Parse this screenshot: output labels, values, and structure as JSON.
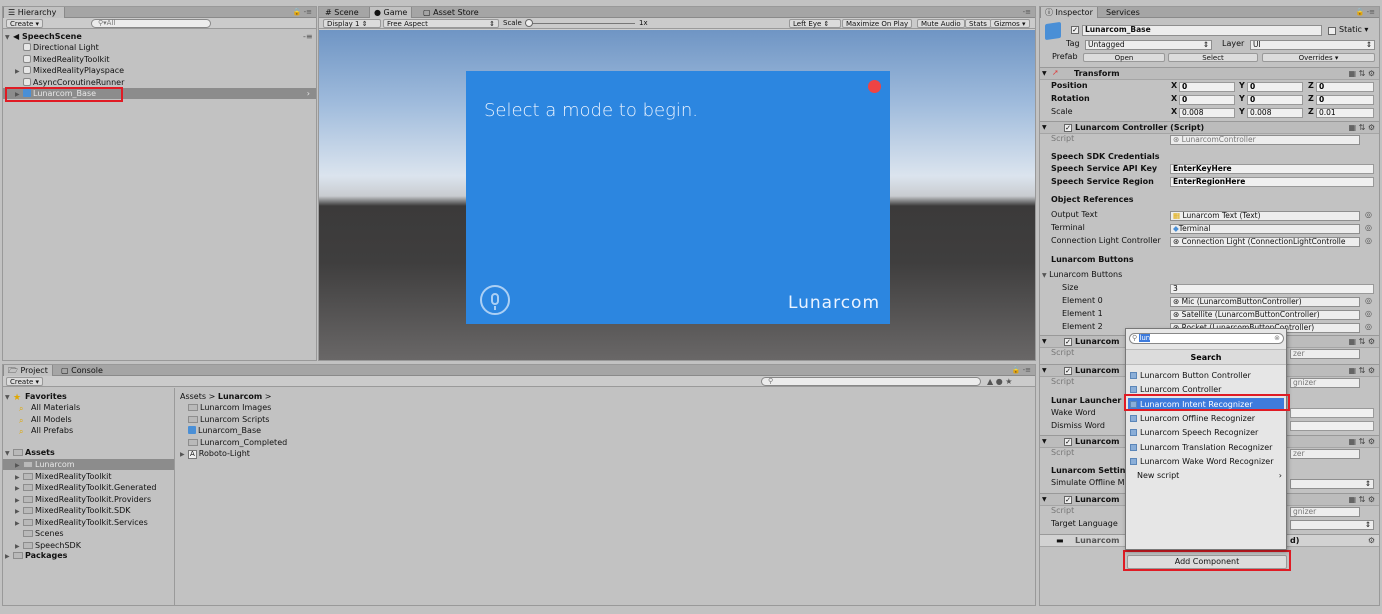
{
  "hierarchy": {
    "tab_label": "Hierarchy",
    "create_label": "Create",
    "search_placeholder": "All",
    "scene_name": "SpeechScene",
    "items": [
      {
        "label": "Directional Light",
        "expandable": false
      },
      {
        "label": "MixedRealityToolkit",
        "expandable": false
      },
      {
        "label": "MixedRealityPlayspace",
        "expandable": true
      },
      {
        "label": "AsyncCoroutineRunner",
        "expandable": false
      },
      {
        "label": "Lunarcom_Base",
        "expandable": true,
        "selected": true
      }
    ]
  },
  "game_view": {
    "tabs": [
      "Scene",
      "Game",
      "Asset Store"
    ],
    "toolbar": {
      "display": "Display 1",
      "aspect": "Free Aspect",
      "scale_label": "Scale",
      "scale_value": "1x",
      "eye": "Left Eye",
      "maximize": "Maximize On Play",
      "mute": "Mute Audio",
      "stats": "Stats",
      "gizmos": "Gizmos"
    },
    "panel_title": "Select a mode to begin.",
    "panel_brand": "Lunarcom",
    "panel_color": "#2c86e0",
    "status_dot_color": "#ef4444"
  },
  "project": {
    "tabs": [
      "Project",
      "Console"
    ],
    "create_label": "Create",
    "favorites_label": "Favorites",
    "favorites": [
      "All Materials",
      "All Models",
      "All Prefabs"
    ],
    "assets_label": "Assets",
    "asset_folders": [
      {
        "label": "Lunarcom",
        "selected": true
      },
      {
        "label": "MixedRealityToolkit",
        "selected": false
      },
      {
        "label": "MixedRealityToolkit.Generated",
        "selected": false
      },
      {
        "label": "MixedRealityToolkit.Providers",
        "selected": false
      },
      {
        "label": "MixedRealityToolkit.SDK",
        "selected": false
      },
      {
        "label": "MixedRealityToolkit.Services",
        "selected": false
      },
      {
        "label": "Scenes",
        "selected": false
      },
      {
        "label": "SpeechSDK",
        "selected": false
      }
    ],
    "packages_label": "Packages",
    "breadcrumb": [
      "Assets",
      "Lunarcom"
    ],
    "contents": [
      {
        "label": "Lunarcom Images",
        "kind": "folder"
      },
      {
        "label": "Lunarcom Scripts",
        "kind": "folder"
      },
      {
        "label": "Lunarcom_Base",
        "kind": "prefab"
      },
      {
        "label": "Lunarcom_Completed",
        "kind": "folder"
      },
      {
        "label": "Roboto-Light",
        "kind": "font"
      }
    ]
  },
  "inspector": {
    "tabs": [
      "Inspector",
      "Services"
    ],
    "object_name": "Lunarcom_Base",
    "static_label": "Static",
    "tag_label": "Tag",
    "tag_value": "Untagged",
    "layer_label": "Layer",
    "layer_value": "UI",
    "prefab_label": "Prefab",
    "prefab_open": "Open",
    "prefab_select": "Select",
    "prefab_overrides": "Overrides",
    "transform": {
      "title": "Transform",
      "position_label": "Position",
      "rotation_label": "Rotation",
      "scale_label": "Scale",
      "position": [
        "0",
        "0",
        "0"
      ],
      "rotation": [
        "0",
        "0",
        "0"
      ],
      "scale": [
        "0.008",
        "0.008",
        "0.01"
      ]
    },
    "controller": {
      "title": "Lunarcom Controller (Script)",
      "script_label": "Script",
      "script_value": "LunarcomController",
      "creds_header": "Speech SDK Credentials",
      "api_key_label": "Speech Service API Key",
      "api_key_value": "EnterKeyHere",
      "region_label": "Speech Service Region",
      "region_value": "EnterRegionHere",
      "refs_header": "Object References",
      "output_text_label": "Output Text",
      "output_text_value": "Lunarcom Text (Text)",
      "terminal_label": "Terminal",
      "terminal_value": "Terminal",
      "conn_label": "Connection Light Controller",
      "conn_value": "Connection Light (ConnectionLightControlle",
      "buttons_header": "Lunarcom Buttons",
      "buttons_fold": "Lunarcom Buttons",
      "size_label": "Size",
      "size_value": "3",
      "elements": [
        {
          "label": "Element 0",
          "value": "Mic (LunarcomButtonController)"
        },
        {
          "label": "Element 1",
          "value": "Satellite (LunarcomButtonController)"
        },
        {
          "label": "Element 2",
          "value": "Rocket (LunarcomButtonController)"
        }
      ]
    },
    "partial_components": [
      {
        "title": "Lunarcom",
        "script_label": "Script",
        "script_tail": "zer"
      },
      {
        "title": "Lunarcom",
        "script_label": "Script",
        "script_tail": "gnizer"
      },
      {
        "title": "Lunarcom",
        "script_label": "Script",
        "script_tail": "zer"
      },
      {
        "title": "Lunarcom",
        "script_label": "Script",
        "script_tail": "gnizer"
      }
    ],
    "launcher_header": "Lunar Launcher",
    "wake_word_label": "Wake Word",
    "dismiss_word_label": "Dismiss Word",
    "settings_header": "Lunarcom Settin",
    "simulate_label": "Simulate Offline M",
    "target_lang_label": "Target Language",
    "missing_row": {
      "left": "Lunarcom",
      "right": "d)"
    },
    "add_component_label": "Add Component"
  },
  "component_popup": {
    "search_value": "lun",
    "header": "Search",
    "items": [
      {
        "label": "Lunarcom Button Controller",
        "highlighted": false
      },
      {
        "label": "Lunarcom Controller",
        "highlighted": false
      },
      {
        "label": "Lunarcom Intent Recognizer",
        "highlighted": true
      },
      {
        "label": "Lunarcom Offline Recognizer",
        "highlighted": false
      },
      {
        "label": "Lunarcom Speech Recognizer",
        "highlighted": false
      },
      {
        "label": "Lunarcom Translation Recognizer",
        "highlighted": false
      },
      {
        "label": "Lunarcom Wake Word Recognizer",
        "highlighted": false
      }
    ],
    "new_script_label": "New script",
    "highlight_color": "#3e7bdc"
  },
  "annotation_color": "#e01b24"
}
